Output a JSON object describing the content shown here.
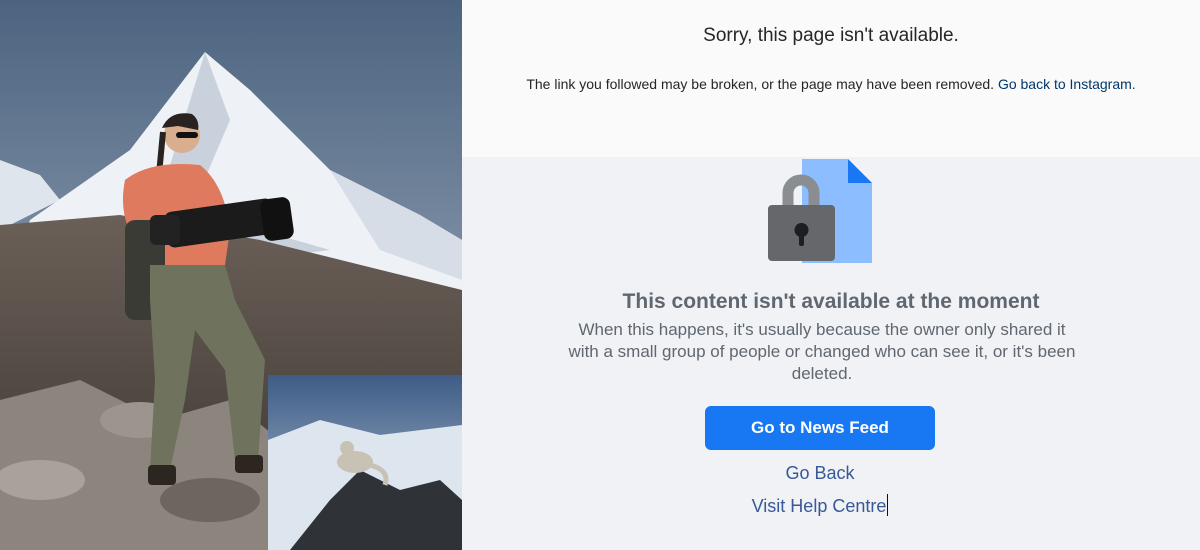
{
  "photo": {
    "alt": "Woman photographer with telephoto lens in snowy mountains; inset of snow leopard on rocks"
  },
  "instagram": {
    "title": "Sorry, this page isn't available.",
    "message": "The link you followed may be broken, or the page may have been removed.",
    "link": "Go back to Instagram."
  },
  "facebook": {
    "icon": "lock-document-icon",
    "title": "This content isn't available at the moment",
    "description": "When this happens, it's usually because the owner only shared it with a small group of people or changed who can see it, or it's been deleted.",
    "primary_button": "Go to News Feed",
    "go_back_link": "Go Back",
    "help_link": "Visit Help Centre"
  },
  "colors": {
    "primary": "#1877f2",
    "link": "#385898",
    "text_muted": "#606770",
    "ig_link": "#00376b"
  }
}
